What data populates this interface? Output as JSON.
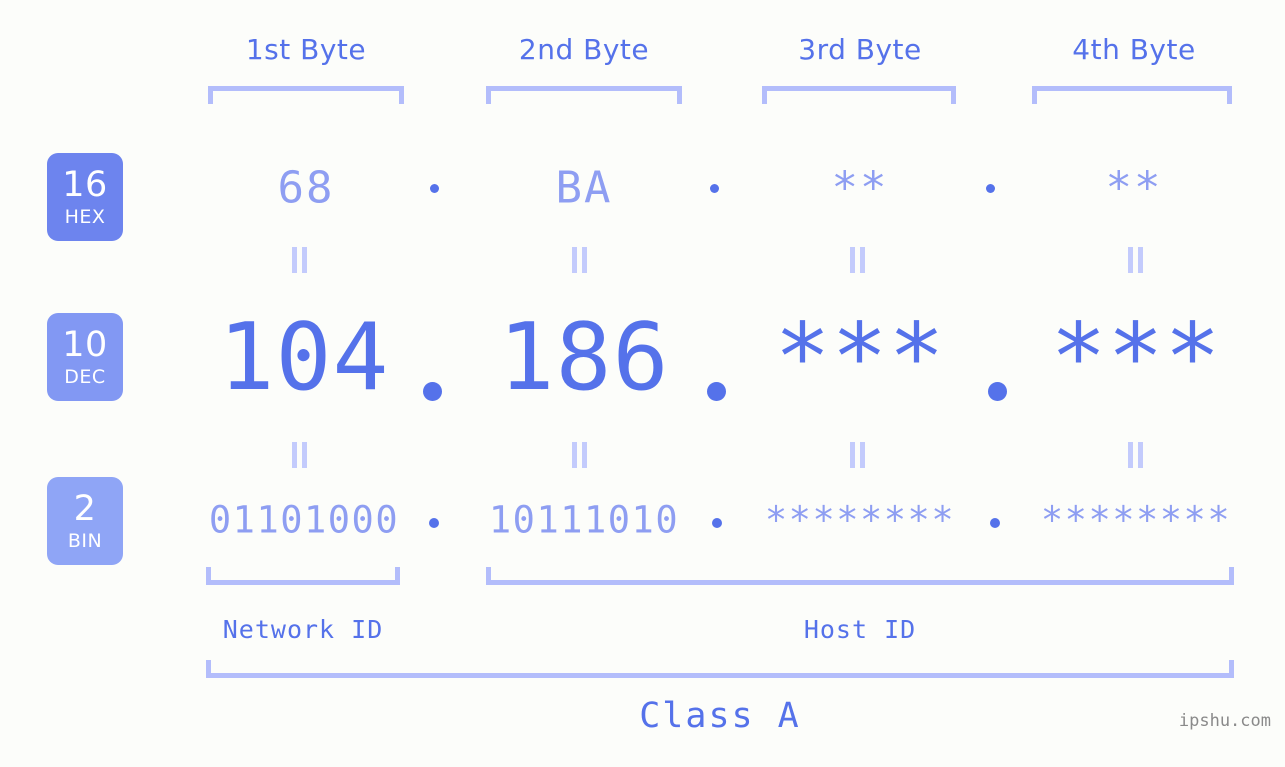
{
  "watermark": "ipshu.com",
  "byte_headers": [
    {
      "label": "1st Byte"
    },
    {
      "label": "2nd Byte"
    },
    {
      "label": "3rd Byte"
    },
    {
      "label": "4th Byte"
    }
  ],
  "radix_badges": [
    {
      "num": "16",
      "name": "HEX",
      "color": "#6d84ee"
    },
    {
      "num": "10",
      "name": "DEC",
      "color": "#8298f3"
    },
    {
      "num": "2",
      "name": "BIN",
      "color": "#8fa5f6"
    }
  ],
  "rows": {
    "hex": {
      "radix": "16",
      "name": "HEX",
      "values": [
        "68",
        "BA",
        "**",
        "**"
      ],
      "separator": "."
    },
    "dec": {
      "radix": "10",
      "name": "DEC",
      "values": [
        "104",
        "186",
        "***",
        "***"
      ],
      "separator": "."
    },
    "bin": {
      "radix": "2",
      "name": "BIN",
      "values": [
        "01101000",
        "10111010",
        "********",
        "********"
      ],
      "separator": "."
    }
  },
  "equals_marks": {
    "glyph": "="
  },
  "segments": {
    "network_id": "Network ID",
    "host_id": "Host ID",
    "class": "Class A"
  },
  "colors": {
    "background": "#fcfdfa",
    "accent_strong": "#5572ea",
    "accent_light": "#8e9ef2",
    "bracket": "#b3bdfb",
    "equals": "#c3cbfc",
    "watermark": "#8a8a8a"
  },
  "ip_info": {
    "address_dec": "104.186.***.***",
    "address_hex": "68.BA.**.**",
    "class": "Class A"
  }
}
